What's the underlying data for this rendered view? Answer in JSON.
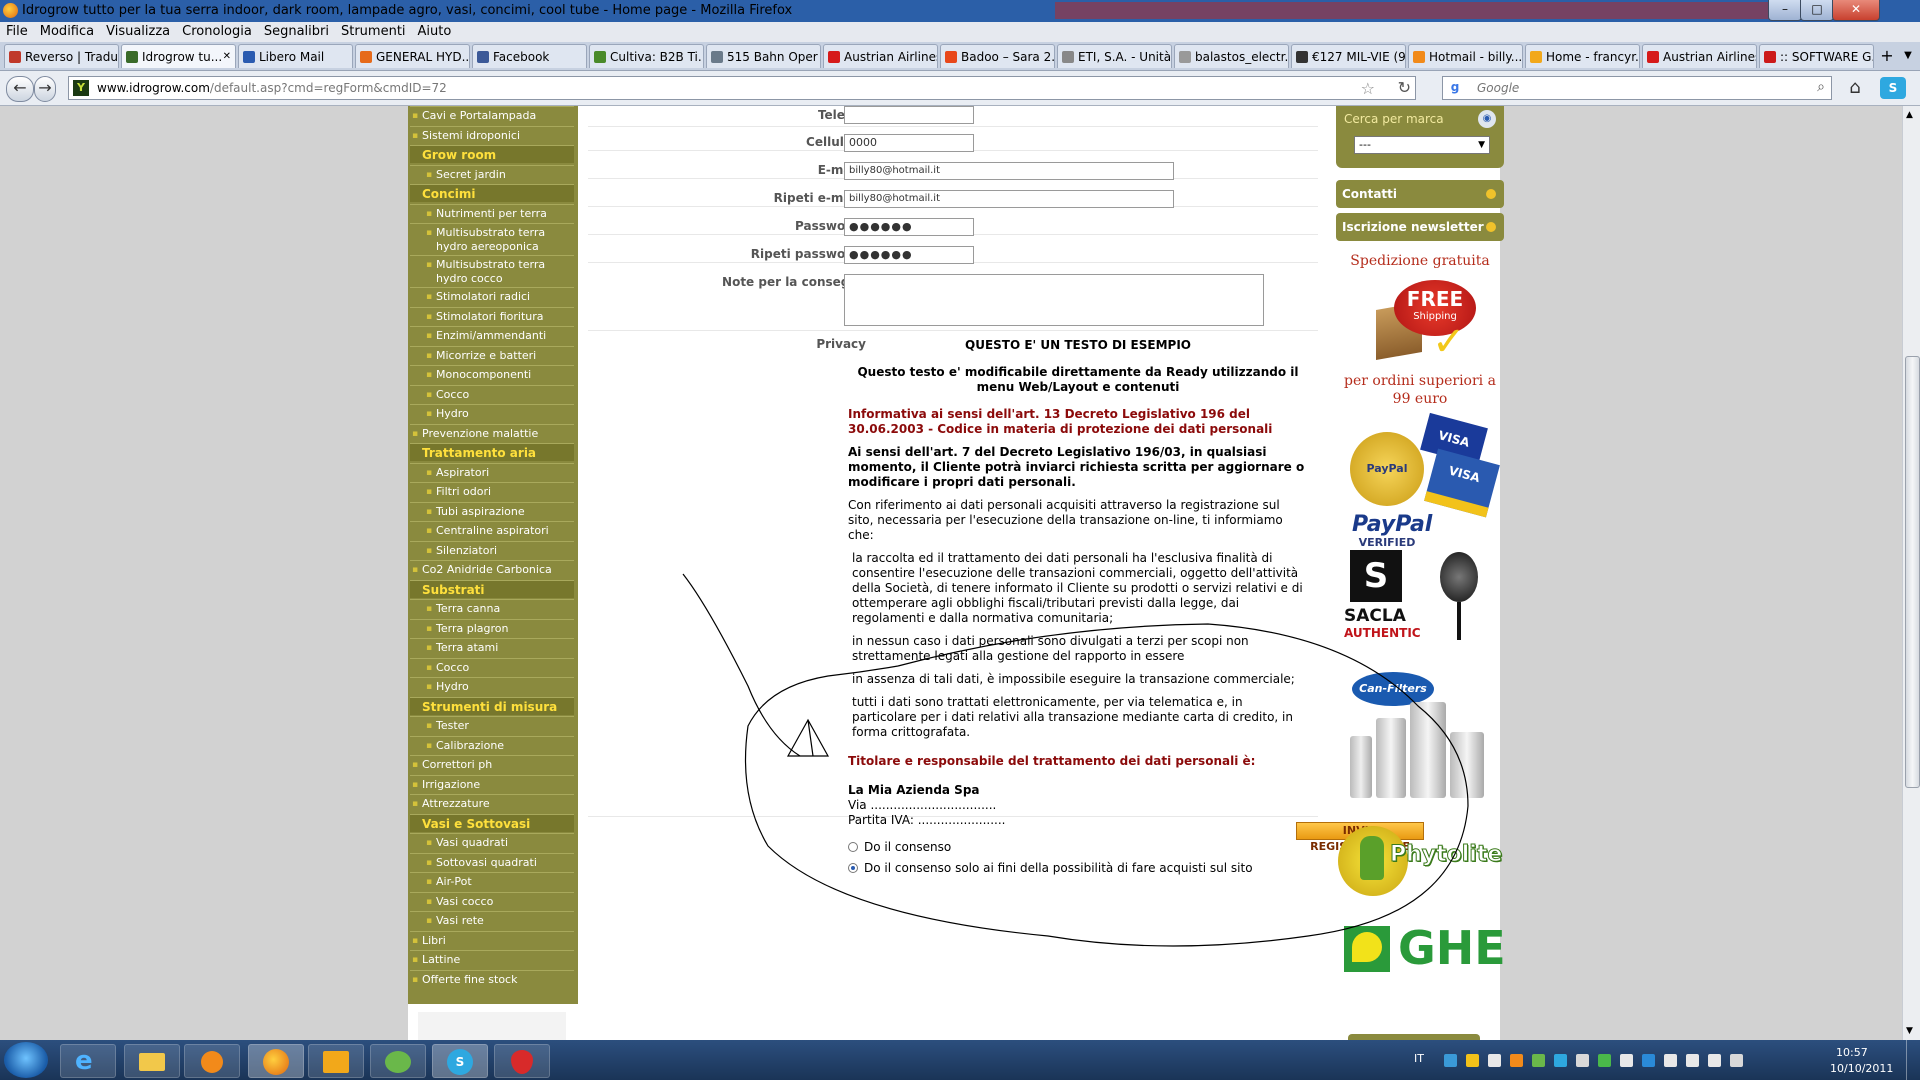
{
  "window": {
    "title": "Idrogrow tutto per la tua serra indoor, dark room, lampade agro, vasi, concimi, cool tube - Home page - Mozilla Firefox",
    "controls": [
      "–",
      "□",
      "✕"
    ]
  },
  "menu": [
    "File",
    "Modifica",
    "Visualizza",
    "Cronologia",
    "Segnalibri",
    "Strumenti",
    "Aiuto"
  ],
  "tabs": [
    {
      "label": "Reverso | Tradu...",
      "color": "#c0392b"
    },
    {
      "label": "Idrogrow tu...",
      "color": "#3a6b2a",
      "active": true
    },
    {
      "label": "Libero Mail",
      "color": "#2a5bb0"
    },
    {
      "label": "GENERAL HYD...",
      "color": "#e66a1a"
    },
    {
      "label": "Facebook",
      "color": "#3b5998"
    },
    {
      "label": "Cultiva: B2B Ti...",
      "color": "#4a8a2a"
    },
    {
      "label": "515 Bahn Oper ...",
      "color": "#6a7a8a"
    },
    {
      "label": "Austrian Airlines",
      "color": "#d61a1a"
    },
    {
      "label": "Badoo – Sara 2...",
      "color": "#e8471a"
    },
    {
      "label": "ETI, S.A. - Unità...",
      "color": "#888888"
    },
    {
      "label": "balastos_electr...",
      "color": "#999999"
    },
    {
      "label": "€127 MIL-VIE (9...",
      "color": "#333333"
    },
    {
      "label": "Hotmail - billy...",
      "color": "#f18a1a"
    },
    {
      "label": "Home - francyr...",
      "color": "#f2a81a"
    },
    {
      "label": "Austrian Airlines",
      "color": "#d61a1a"
    },
    {
      "label": ":: SOFTWARE G...",
      "color": "#cc1a1a"
    }
  ],
  "nav": {
    "url_domain": "www.idrogrow.com",
    "url_path": "/default.asp?cmd=regForm&cmdID=72",
    "search_placeholder": "Google"
  },
  "sidebar": [
    {
      "label": "Cavi e Portalampada",
      "level": 1
    },
    {
      "label": "Sistemi idroponici",
      "level": 1
    },
    {
      "label": "Grow room",
      "level": 0
    },
    {
      "label": "Secret jardin",
      "level": 2
    },
    {
      "label": "Concimi",
      "level": 0
    },
    {
      "label": "Nutrimenti per terra",
      "level": 2
    },
    {
      "label": "Multisubstrato terra hydro aereoponica",
      "level": 2,
      "wrap": true
    },
    {
      "label": "Multisubstrato terra hydro cocco",
      "level": 2,
      "wrap": true
    },
    {
      "label": "Stimolatori radici",
      "level": 2
    },
    {
      "label": "Stimolatori fioritura",
      "level": 2
    },
    {
      "label": "Enzimi/ammendanti",
      "level": 2
    },
    {
      "label": "Micorrize e batteri",
      "level": 2
    },
    {
      "label": "Monocomponenti",
      "level": 2
    },
    {
      "label": "Cocco",
      "level": 2
    },
    {
      "label": "Hydro",
      "level": 2
    },
    {
      "label": "Prevenzione malattie",
      "level": 1
    },
    {
      "label": "Trattamento aria",
      "level": 0
    },
    {
      "label": "Aspiratori",
      "level": 2
    },
    {
      "label": "Filtri odori",
      "level": 2
    },
    {
      "label": "Tubi aspirazione",
      "level": 2
    },
    {
      "label": "Centraline aspiratori",
      "level": 2
    },
    {
      "label": "Silenziatori",
      "level": 2
    },
    {
      "label": "Co2 Anidride Carbonica",
      "level": 1
    },
    {
      "label": "Substrati",
      "level": 0
    },
    {
      "label": "Terra canna",
      "level": 2
    },
    {
      "label": "Terra plagron",
      "level": 2
    },
    {
      "label": "Terra atami",
      "level": 2
    },
    {
      "label": "Cocco",
      "level": 2
    },
    {
      "label": "Hydro",
      "level": 2
    },
    {
      "label": "Strumenti di misura",
      "level": 0
    },
    {
      "label": "Tester",
      "level": 2
    },
    {
      "label": "Calibrazione",
      "level": 2
    },
    {
      "label": "Correttori ph",
      "level": 1
    },
    {
      "label": "Irrigazione",
      "level": 1
    },
    {
      "label": "Attrezzature",
      "level": 1
    },
    {
      "label": "Vasi e Sottovasi",
      "level": 0
    },
    {
      "label": "Vasi quadrati",
      "level": 2
    },
    {
      "label": "Sottovasi quadrati",
      "level": 2
    },
    {
      "label": "Air-Pot",
      "level": 2
    },
    {
      "label": "Vasi cocco",
      "level": 2
    },
    {
      "label": "Vasi rete",
      "level": 2
    },
    {
      "label": "Libri",
      "level": 1
    },
    {
      "label": "Lattine",
      "level": 1
    },
    {
      "label": "Offerte fine stock",
      "level": 1
    }
  ],
  "form": {
    "telefax_label": "Telefax",
    "telefax_value": "",
    "cellulare_label": "Cellulare",
    "cellulare_value": "0000",
    "email_label": "E-mail*",
    "email_value": "billy80@hotmail.it",
    "email2_label": "Ripeti e-mail*",
    "email2_value": "billy80@hotmail.it",
    "password_label": "Password*",
    "password_value": "●●●●●●",
    "password2_label": "Ripeti password*",
    "password2_value": "●●●●●●",
    "note_label": "Note per la consegna",
    "note_value": "",
    "privacy_label": "Privacy"
  },
  "privacy": {
    "heading": "QUESTO E' UN TESTO DI ESEMPIO",
    "subheading": "Questo testo e' modificabile direttamente da Ready utilizzando il menu Web/Layout e contenuti",
    "informativa": "Informativa ai sensi dell'art. 13 Decreto Legislativo 196 del 30.06.2003 - Codice in materia di protezione dei dati personali",
    "art7": "Ai sensi dell'art. 7 del Decreto Legislativo 196/03, in qualsiasi momento, il Cliente potrà inviarci richiesta scritta per aggiornare o modificare i propri dati personali.",
    "riferimento": "Con riferimento ai dati personali acquisiti attraverso la registrazione sul sito, necessaria per l'esecuzione della transazione on-line, ti informiamo che:",
    "point1": "la raccolta ed il trattamento dei dati personali ha l'esclusiva finalità di consentire l'esecuzione delle transazioni commerciali, oggetto dell'attività della Società, di tenere informato il Cliente su prodotti o servizi relativi e di ottemperare agli obblighi fiscali/tributari previsti dalla legge, dai regolamenti e dalla normativa comunitaria;",
    "point2": "in nessun caso i dati personali sono divulgati a terzi per scopi non strettamente legati alla gestione del rapporto in essere",
    "point3": "in assenza di tali dati, è impossibile eseguire la transazione commerciale;",
    "point4": "tutti i dati sono trattati elettronicamente, per via telematica e, in particolare per i dati relativi alla transazione mediante carta di credito, in forma crittografata.",
    "titolare": "Titolare e responsabile del trattamento dei dati personali è:",
    "azienda": "La Mia Azienda Spa",
    "via": "Via .................................",
    "piva": "Partita IVA: .......................",
    "consenso1": "Do il consenso",
    "consenso2": "Do il consenso solo ai fini della possibilità di fare acquisti sul sito",
    "submit": "INVIA REGISTRAZIONE"
  },
  "right": {
    "brand_label": "Cerca per marca",
    "brand_select": "---",
    "contatti": "Contatti",
    "newsletter": "Iscrizione newsletter",
    "spedizione": "Spedizione gratuita",
    "free": "FREE",
    "shipping": "Shipping",
    "ordini": "per ordini superiori a 99 euro",
    "paypal_verified": "PayPal VERIFIED",
    "paypal": "PayPal",
    "visa1": "VISA",
    "visa2": "VISA",
    "sacla": "SACLA",
    "authentic": "AUTHENTIC",
    "canfilters": "Can-Filters",
    "phytolite": "Phytolite",
    "ghe": "GHE"
  },
  "tray": {
    "lang": "IT",
    "time": "10:57",
    "date": "10/10/2011"
  }
}
